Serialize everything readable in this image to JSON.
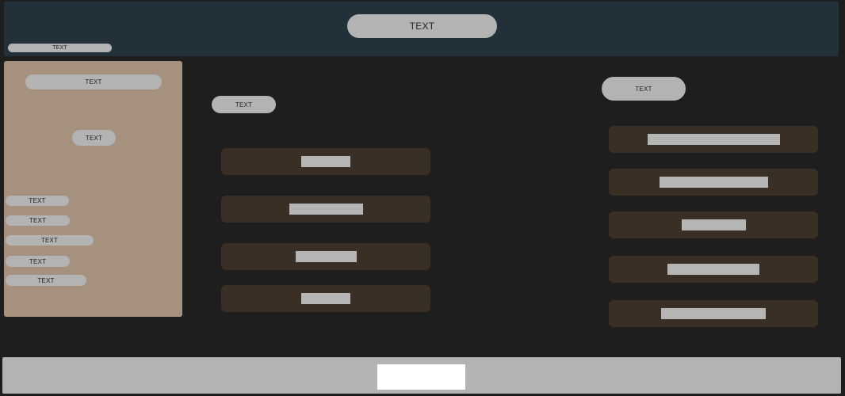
{
  "header": {
    "title": "TEXT",
    "subtitle": "TEXT"
  },
  "sidebar": {
    "heading": "TEXT",
    "button": "TEXT",
    "items": [
      {
        "label": "TEXT"
      },
      {
        "label": "TEXT"
      },
      {
        "label": "TEXT"
      },
      {
        "label": "TEXT"
      },
      {
        "label": "TEXT"
      }
    ]
  },
  "middle": {
    "heading": "TEXT"
  },
  "right": {
    "heading": "TEXT"
  },
  "colors": {
    "background": "#1e1e1e",
    "header": "#22303a",
    "sidebar": "#a6907e",
    "card": "#392f25",
    "placeholder": "#b3b3b3",
    "footer_box": "#ffffff"
  }
}
